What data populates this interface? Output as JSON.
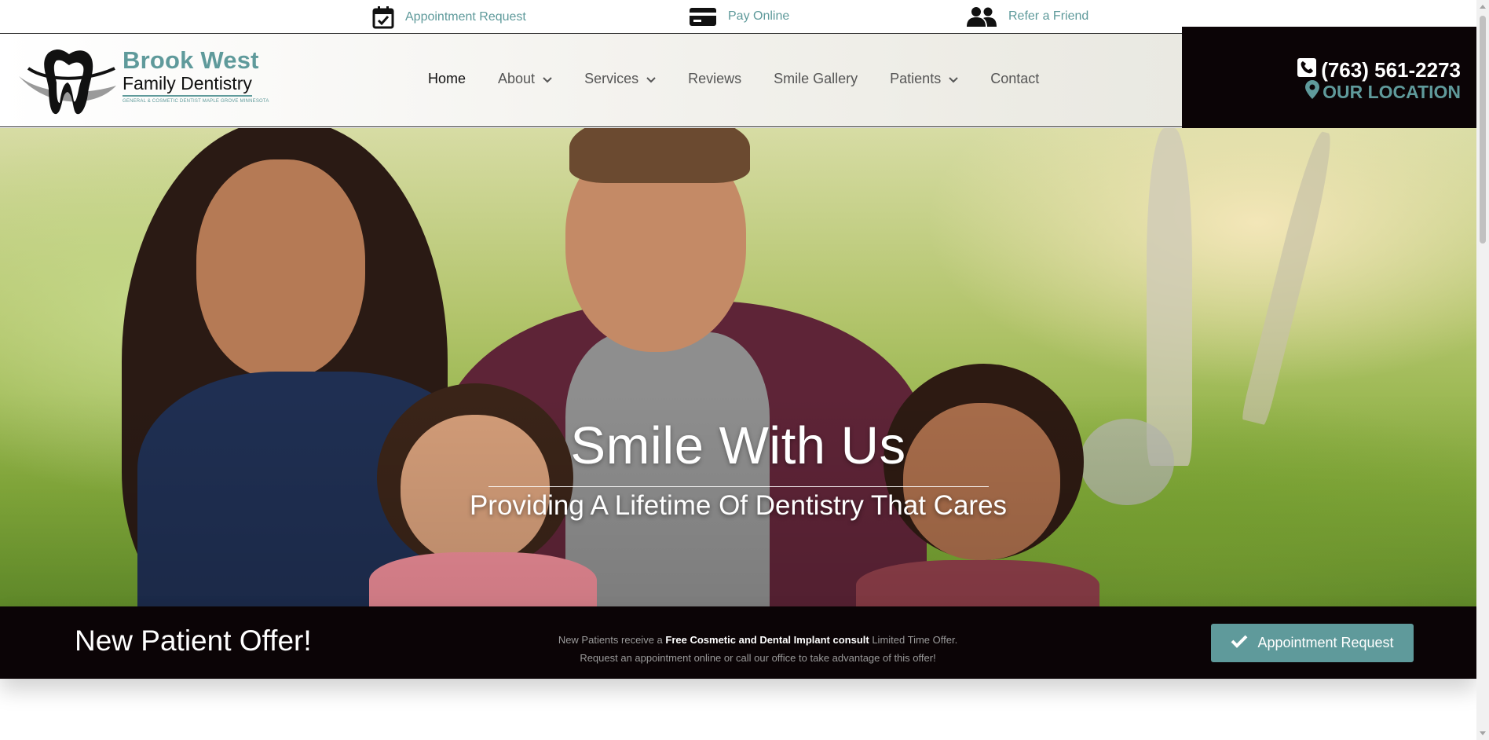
{
  "topbar": {
    "links": [
      {
        "label": "Appointment Request",
        "icon": "calendar-check-icon"
      },
      {
        "label": "Pay Online",
        "icon": "credit-card-icon"
      },
      {
        "label": "Refer a Friend",
        "icon": "users-icon"
      }
    ]
  },
  "logo": {
    "title": "Brook West",
    "subtitle": "Family Dentistry",
    "tagline": "GENERAL & COSMETIC DENTIST MAPLE GROVE MINNESOTA"
  },
  "nav": {
    "items": [
      {
        "label": "Home",
        "active": true
      },
      {
        "label": "About",
        "dropdown": true
      },
      {
        "label": "Services",
        "dropdown": true
      },
      {
        "label": "Reviews"
      },
      {
        "label": "Smile Gallery"
      },
      {
        "label": "Patients",
        "dropdown": true
      },
      {
        "label": "Contact"
      }
    ]
  },
  "contact": {
    "phone": "(763) 561-2273",
    "location": "OUR LOCATION"
  },
  "hero": {
    "title": "Smile With Us",
    "subtitle": "Providing A Lifetime Of Dentistry That Cares"
  },
  "offer": {
    "title": "New Patient Offer!",
    "line1_pre": "New Patients receive a ",
    "line1_bold": "Free Cosmetic and Dental Implant consult",
    "line1_post": " Limited Time Offer.",
    "line2": "Request an appointment online or call our office to take advantage of this offer!",
    "button_label": "Appointment Request"
  },
  "colors": {
    "accent": "#5f9a9b",
    "dark": "#0b0406"
  }
}
